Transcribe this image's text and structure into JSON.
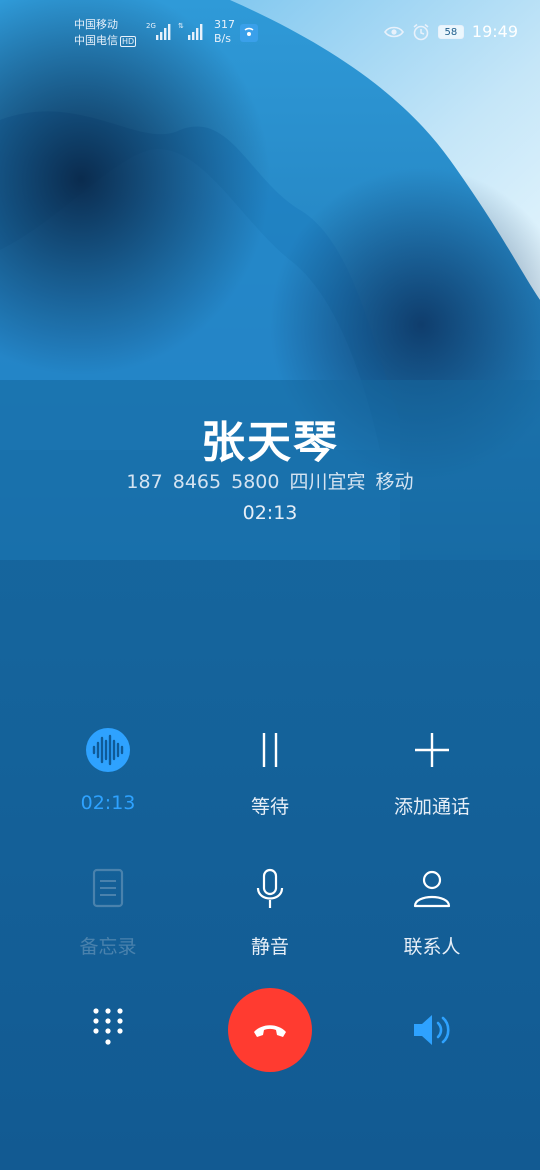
{
  "status_bar": {
    "carrier_1": "中国移动",
    "carrier_2": "中国电信",
    "hd_badge": "HD",
    "network_1": "2G",
    "speed_value": "317",
    "speed_unit": "B/s",
    "battery": "58",
    "time": "19:49"
  },
  "caller": {
    "name": "张天琴",
    "number_location": "187 8465 5800  四川宜宾 移动",
    "duration": "02:13"
  },
  "controls": {
    "recording_label": "02:13",
    "hold_label": "等待",
    "add_call_label": "添加通话",
    "notes_label": "备忘录",
    "mute_label": "静音",
    "contacts_label": "联系人"
  },
  "colors": {
    "background": "#16679f",
    "accent": "#2ea2ff",
    "end_call": "#ff3b30"
  },
  "icons": [
    "voice-wave-icon",
    "pause-icon",
    "plus-icon",
    "notes-icon",
    "microphone-icon",
    "person-icon",
    "dialpad-icon",
    "end-call-icon",
    "speaker-icon"
  ]
}
